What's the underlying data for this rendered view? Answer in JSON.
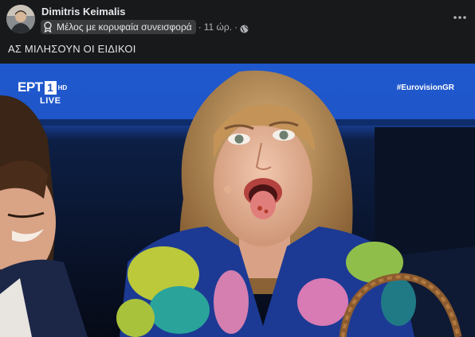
{
  "post": {
    "author": "Dimitris Keimalis",
    "badge_label": "Μέλος με κορυφαία συνεισφορά",
    "badge_icon": "top-contributor-badge-icon",
    "time": "11 ώρ.",
    "separator": "·",
    "audience_icon": "globe-icon",
    "more_icon": "more-options-icon",
    "text": "ΑΣ ΜΙΛΗΣΟΥΝ ΟΙ ΕΙΔΙΚΟΙ"
  },
  "photo": {
    "broadcaster_logo": "ΕΡΤ",
    "channel_number": "1",
    "hd_label": "HD",
    "live_label": "LIVE",
    "hashtag": "#EurovisionGR"
  },
  "colors": {
    "background": "#18191a",
    "stage_blue": "#1f56c8",
    "badge_bg": "#3a3b3c"
  }
}
